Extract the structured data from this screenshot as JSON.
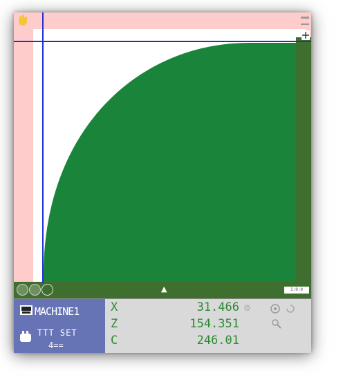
{
  "viewport": {
    "background_color": "#ffcccc",
    "work_area_color": "#ffffff",
    "part_color": "#1a853a",
    "stock_color": "#3e6f2e",
    "guide_color": "#1e2fd6",
    "bottom_tag": "1:0:0"
  },
  "status_panel": {
    "machine_name": "MACHINE1",
    "feed_rate": "TTT SET",
    "feed_sub": "4==",
    "axes": [
      {
        "label": "X",
        "value": "31.466"
      },
      {
        "label": "Z",
        "value": "154.351"
      },
      {
        "label": "C",
        "value": "246.01"
      }
    ],
    "colors": {
      "machine_panel": "#6673b5",
      "readout": "#2d8a33",
      "panel_bg": "#d9d9d9"
    }
  },
  "icons": [
    "hand-icon",
    "window-controls-icon",
    "zoom-minus-icon",
    "rotate-icon",
    "reset-icon",
    "machine-icon",
    "spindle-icon",
    "view-icon",
    "refresh-icon",
    "search-icon"
  ]
}
